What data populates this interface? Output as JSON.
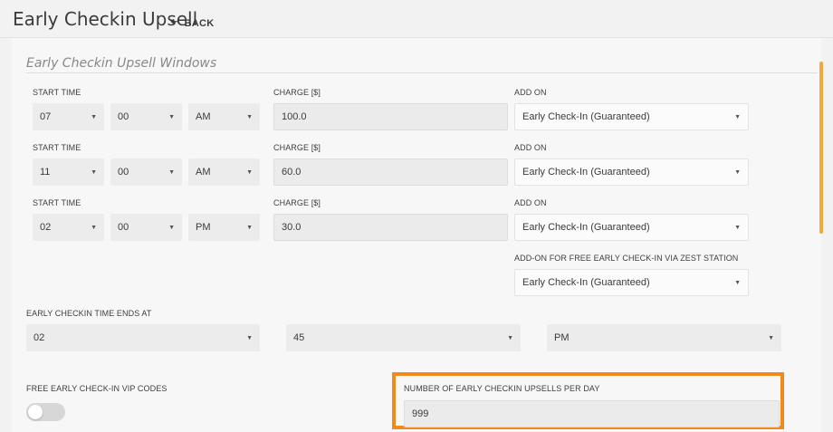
{
  "header": {
    "title": "Early Checkin Upsell",
    "back_label": "BACK",
    "back_icon": "left-arrow-icon"
  },
  "section": {
    "title": "Early Checkin Upsell Windows"
  },
  "labels": {
    "start_time": "START TIME",
    "charge": "CHARGE [$]",
    "add_on": "ADD ON",
    "free_addon": "ADD-ON FOR FREE EARLY CHECK-IN VIA ZEST STATION",
    "ends_at": "EARLY CHECKIN TIME ENDS AT",
    "vip_codes": "FREE EARLY CHECK-IN VIP CODES",
    "upsells_per_day": "NUMBER OF EARLY CHECKIN UPSELLS PER DAY"
  },
  "windows": [
    {
      "hour": "07",
      "minute": "00",
      "ampm": "AM",
      "charge": "100.0",
      "addon": "Early Check-In (Guaranteed)"
    },
    {
      "hour": "11",
      "minute": "00",
      "ampm": "AM",
      "charge": "60.0",
      "addon": "Early Check-In (Guaranteed)"
    },
    {
      "hour": "02",
      "minute": "00",
      "ampm": "PM",
      "charge": "30.0",
      "addon": "Early Check-In (Guaranteed)"
    }
  ],
  "free_addon_value": "Early Check-In (Guaranteed)",
  "ends_at": {
    "hour": "02",
    "minute": "45",
    "ampm": "PM"
  },
  "vip_toggle_on": false,
  "upsells_per_day": "999",
  "colors": {
    "highlight": "#f28a1b",
    "scroll_accent": "#f0a93a"
  }
}
